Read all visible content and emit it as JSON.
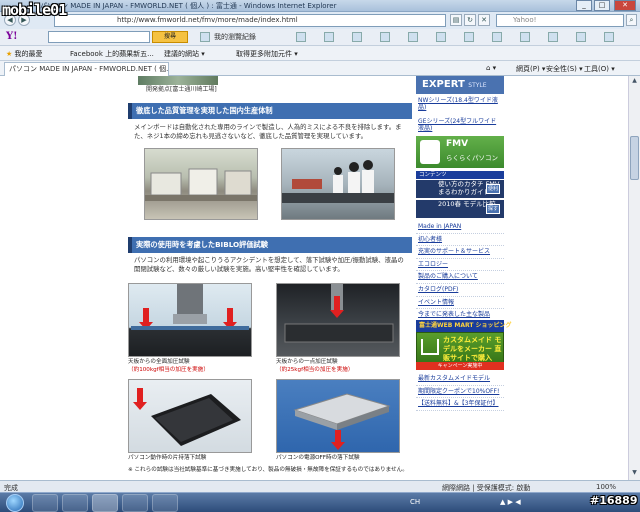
{
  "window": {
    "title": "パソコン MADE IN JAPAN - FMWORLD.NET ( 個人 ) : 富士通 - Windows Internet Explorer",
    "minimize": "_",
    "maximize": "□",
    "close": "✕"
  },
  "address_bar": {
    "url": "http://www.fmworld.net/fmv/more/made/index.html",
    "search_placeholder": "Yahoo!"
  },
  "toolbar": {
    "yahoo_logo": "Y!",
    "search_button": "搜尋",
    "items": [
      "我的瀏覽紀錄",
      "信箱",
      "新聞",
      "拍賣"
    ]
  },
  "favorites": {
    "favorites_label": "我的最愛",
    "links": [
      "Facebook 上的蘋果新五...",
      "建議的網站 ▾",
      "取得更多附加元件 ▾"
    ]
  },
  "tab": {
    "label": "パソコン MADE IN JAPAN - FMWORLD.NET ( 個..."
  },
  "command_bar": {
    "items": [
      "網頁(P) ▾",
      "安全性(S) ▾",
      "工具(O) ▾"
    ]
  },
  "page": {
    "top_caption": "開発拠点[富士通川崎工場]",
    "section1": {
      "heading": "徹底した品質管理を実現した国内生産体制",
      "text": "メインボードは自動化された専用のラインで製造し、人為的ミスによる不良を排除します。また、ネジ1本の締め忘れも見逃さないなど、徹底した品質管理を実現しています。"
    },
    "section2": {
      "heading": "実際の使用時を考慮したBIBLO評価試験",
      "text": "パソコンの利用環境や起こりうるアクシデントを想定して、落下試験や加圧/振動試験、液晶の開閉試験など、数々の厳しい試験を実施。高い堅牢性を確認しています。",
      "tests": [
        {
          "caption": "天板からの全面加圧試験",
          "detail": "（約100kgf相当の加圧を実施）"
        },
        {
          "caption": "天板からの一点加圧試験",
          "detail": "（約25kgf相当の加圧を実施）"
        },
        {
          "caption": "パソコン動作時の片持落下試験",
          "detail": ""
        },
        {
          "caption": "パソコンの電源OFF時の落下試験",
          "detail": ""
        }
      ]
    },
    "footnote": "※ これらの試験は当社試験基準に基づき実施しており、製品の無破損・無故障を保証するものではありません。"
  },
  "sidebar": {
    "expert": {
      "title": "EXPERT",
      "subtitle": "STYLE"
    },
    "expert_links": [
      "NWシリーズ(18.4型ワイド液晶)",
      "GEシリーズ(24型フルワイド液晶)"
    ],
    "fmv_banner": {
      "title": "FMV",
      "subtitle": "らくらくパソコン"
    },
    "contents_label": "コンテンツ",
    "guide": {
      "text": "使い方のカタチ FMVまるわかりガイド",
      "badge": "便利"
    },
    "models": {
      "text": "2010春 モデル比較",
      "badge": "探す"
    },
    "links": [
      "Made in JAPAN",
      "初心者様",
      "充実のサポート＆サービス",
      "エコロジー",
      "製品のご購入について",
      "カタログ(PDF)",
      "イベント情報",
      "今までに発表した主な製品"
    ],
    "webmart_label": "富士通WEB MART ショッピング",
    "webmart_banner": "カスタムメイド モデルをメーカー 直販サイトで購入",
    "webmart_strip": "キャンペーン実施中",
    "bottom_links": [
      "最新カスタムメイドモデル",
      "期間限定クーポンで10%OFF!",
      "【送料無料】&【3年保証付】"
    ]
  },
  "status_bar": {
    "left": "完成",
    "zone": "網際網路 | 受保護模式: 啟動",
    "zoom": "100%"
  },
  "taskbar": {
    "lang": "CH",
    "time": "▲ ▶ ◀"
  },
  "overlay": {
    "logo_text": "mobile01",
    "watermark": "#16889"
  }
}
